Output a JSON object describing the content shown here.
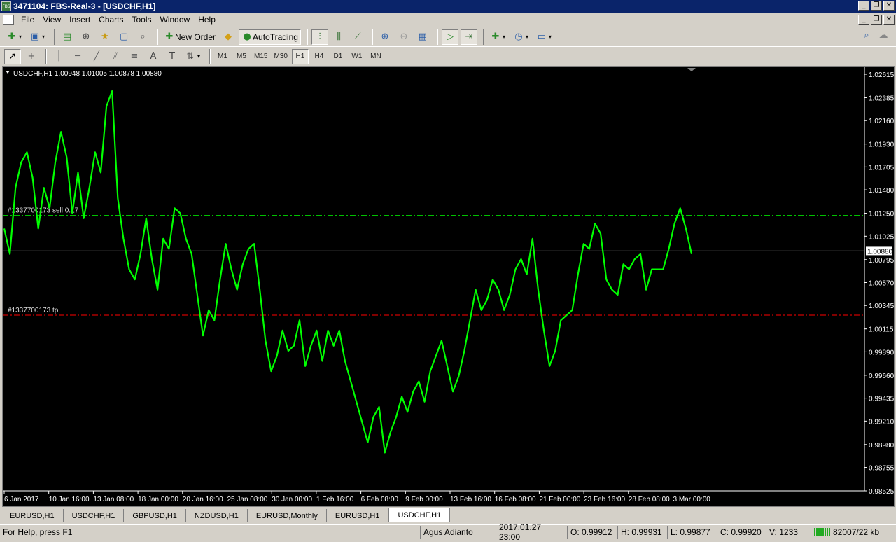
{
  "window": {
    "app_icon_text": "FBS",
    "title": "3471104: FBS-Real-3 - [USDCHF,H1]",
    "controls": [
      "_",
      "❐",
      "✕"
    ]
  },
  "menu": {
    "items": [
      "File",
      "View",
      "Insert",
      "Charts",
      "Tools",
      "Window",
      "Help"
    ]
  },
  "toolbar": {
    "new_order_label": "New Order",
    "autotrading_label": "AutoTrading",
    "timeframes": [
      "M1",
      "M5",
      "M15",
      "M30",
      "H1",
      "H4",
      "D1",
      "W1",
      "MN"
    ],
    "active_timeframe": "H1"
  },
  "chart": {
    "info": "USDCHF,H1  1.00948 1.01005 1.00878 1.00880",
    "current_price": "1.00880",
    "sell_label": "#1337700173 sell 0.17",
    "tp_label": "#1337700173 tp",
    "colors": {
      "background": "#000000",
      "price": "#00ff00",
      "sell_line": "#00c000",
      "tp_line": "#ff0000",
      "bid_line": "#c0c0c0",
      "text": "#ffffff"
    }
  },
  "chart_data": {
    "type": "line",
    "symbol": "USDCHF",
    "timeframe": "H1",
    "x_tick_labels": [
      "6 Jan 2017",
      "10 Jan 16:00",
      "13 Jan 08:00",
      "18 Jan 00:00",
      "20 Jan 16:00",
      "25 Jan 08:00",
      "30 Jan 00:00",
      "1 Feb 16:00",
      "6 Feb 08:00",
      "9 Feb 00:00",
      "13 Feb 16:00",
      "16 Feb 08:00",
      "21 Feb 00:00",
      "23 Feb 16:00",
      "28 Feb 08:00",
      "3 Mar 00:00"
    ],
    "y_tick_labels": [
      "1.02615",
      "1.02385",
      "1.02160",
      "1.01930",
      "1.01705",
      "1.01480",
      "1.01250",
      "1.01025",
      "1.00795",
      "1.00570",
      "1.00345",
      "1.00115",
      "0.99890",
      "0.99660",
      "0.99435",
      "0.99210",
      "0.98980",
      "0.98755",
      "0.98525"
    ],
    "ylim": [
      0.98525,
      1.02615
    ],
    "sell_level": 1.0123,
    "tp_level": 1.0025,
    "bid": 1.0088,
    "series": [
      {
        "values": [
          1.011,
          1.0085,
          1.015,
          1.0175,
          1.0185,
          1.016,
          1.011,
          1.015,
          1.013,
          1.0175,
          1.0205,
          1.018,
          1.0125,
          1.0165,
          1.012,
          1.015,
          1.0185,
          1.0165,
          1.023,
          1.0245,
          1.014,
          1.01,
          1.007,
          1.006,
          1.0085,
          1.012,
          1.008,
          1.005,
          1.01,
          1.009,
          1.013,
          1.0125,
          1.01,
          1.0085,
          1.0045,
          1.0005,
          1.003,
          1.002,
          1.006,
          1.0095,
          1.007,
          1.005,
          1.0075,
          1.009,
          1.0095,
          1.005,
          1.0,
          0.997,
          0.9985,
          1.001,
          0.999,
          0.9995,
          1.002,
          0.9975,
          0.9995,
          1.001,
          0.998,
          1.001,
          0.9995,
          1.001,
          0.998,
          0.996,
          0.994,
          0.992,
          0.99,
          0.9925,
          0.9935,
          0.989,
          0.991,
          0.9925,
          0.9945,
          0.993,
          0.995,
          0.996,
          0.994,
          0.997,
          0.9985,
          1.0,
          0.9975,
          0.995,
          0.9965,
          0.999,
          1.002,
          1.005,
          1.003,
          1.004,
          1.006,
          1.005,
          1.003,
          1.0045,
          1.007,
          1.008,
          1.0065,
          1.01,
          1.005,
          1.001,
          0.9975,
          0.999,
          1.002,
          1.0025,
          1.003,
          1.0065,
          1.0095,
          1.009,
          1.0115,
          1.0105,
          1.006,
          1.005,
          1.0045,
          1.0075,
          1.007,
          1.008,
          1.0085,
          1.005,
          1.007,
          1.007,
          1.007,
          1.009,
          1.0115,
          1.013,
          1.011,
          1.0085
        ],
        "x": [
          "6 Jan 2017",
          "",
          "",
          "",
          "",
          "",
          "",
          "",
          "",
          "",
          "",
          "",
          "",
          "",
          "",
          "",
          "",
          "",
          "",
          "",
          "",
          "",
          "",
          "",
          "",
          "",
          "",
          "",
          "",
          "",
          "",
          "",
          "",
          "",
          "",
          "",
          "",
          "",
          "",
          "",
          "",
          "",
          "",
          "",
          "",
          "",
          "",
          "",
          "",
          "",
          "",
          "",
          "",
          "",
          "",
          "",
          "",
          "",
          "",
          "",
          "",
          "",
          "",
          "",
          "",
          "",
          "",
          "",
          "",
          "",
          "",
          "",
          "",
          "",
          "",
          "",
          "",
          "",
          "",
          "",
          "",
          "",
          "",
          "",
          "",
          "",
          "",
          "",
          "",
          "",
          "",
          "",
          "",
          "",
          "",
          "",
          "",
          "",
          "",
          "",
          "",
          "",
          "",
          "",
          "",
          "",
          "",
          "",
          "",
          "",
          "",
          "",
          "",
          "",
          "",
          "",
          "",
          "",
          "",
          "",
          "",
          "3 Mar 00:00"
        ]
      }
    ]
  },
  "tabs": [
    {
      "label": "EURUSD,H1",
      "active": false
    },
    {
      "label": "USDCHF,H1",
      "active": false
    },
    {
      "label": "GBPUSD,H1",
      "active": false
    },
    {
      "label": "NZDUSD,H1",
      "active": false
    },
    {
      "label": "EURUSD,Monthly",
      "active": false
    },
    {
      "label": "EURUSD,H1",
      "active": false
    },
    {
      "label": "USDCHF,H1",
      "active": true
    }
  ],
  "status": {
    "help": "For Help, press F1",
    "profile": "Agus Adianto",
    "datetime": "2017.01.27 23:00",
    "open": "O: 0.99912",
    "high": "H: 0.99931",
    "low": "L: 0.99877",
    "close": "C: 0.99920",
    "volume": "V: 1233",
    "traffic": "82007/22 kb"
  }
}
